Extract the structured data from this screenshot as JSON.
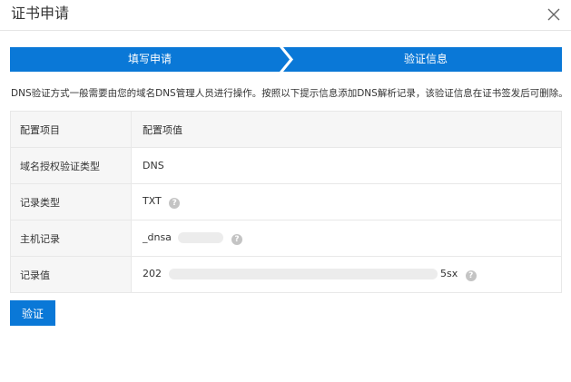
{
  "dialog": {
    "title": "证书申请",
    "close_icon": "close-icon"
  },
  "steps": [
    {
      "label": "填写申请"
    },
    {
      "label": "验证信息"
    }
  ],
  "hint": "DNS验证方式一般需要由您的域名DNS管理人员进行操作。按照以下提示信息添加DNS解析记录，该验证信息在证书签发后可删除。",
  "table": {
    "headers": [
      "配置项目",
      "配置项值"
    ],
    "rows": [
      {
        "key": "域名授权验证类型",
        "value": "DNS"
      },
      {
        "key": "记录类型",
        "value": "TXT"
      },
      {
        "key": "主机记录",
        "value": "_dnsa"
      },
      {
        "key": "记录值",
        "value_prefix": "202",
        "value_suffix": "5sx"
      }
    ]
  },
  "buttons": {
    "verify": "验证"
  },
  "colors": {
    "accent": "#0a78d7",
    "step_bg": "#0a78d7"
  }
}
